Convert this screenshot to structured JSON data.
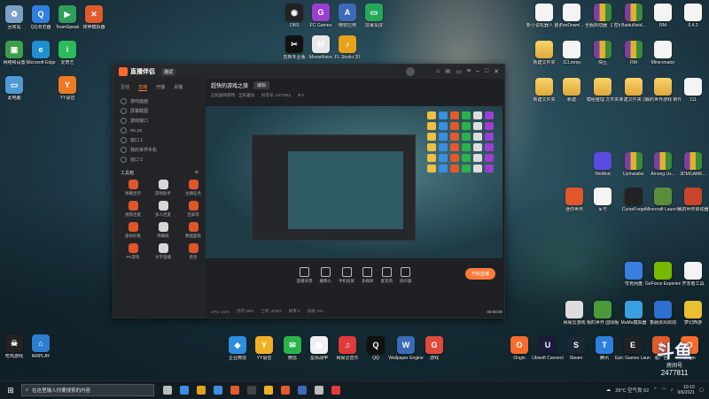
{
  "desktop": {
    "left_icons": [
      {
        "label": "回收站",
        "color": "#7aa0c8",
        "glyph": "♻"
      },
      {
        "label": "QQ浏览器",
        "color": "#2f7fe0",
        "glyph": "Q"
      },
      {
        "label": "TeamSpeak",
        "color": "#2e9e5b",
        "glyph": "▶"
      },
      {
        "label": "夜神模拟器",
        "color": "#e05a2a",
        "glyph": "✕"
      },
      {
        "label": "网络和设置",
        "color": "#3d9e4a",
        "glyph": "▣"
      },
      {
        "label": "Microsoft Edge",
        "color": "#1e8fd0",
        "glyph": "e"
      },
      {
        "label": "爱奇艺",
        "color": "#2bbb5b",
        "glyph": "i"
      },
      {
        "label": "此电脑",
        "color": "#4d9ad6",
        "glyph": "▭"
      },
      {
        "label": "YY语音",
        "color": "#f07a24",
        "glyph": "Y"
      }
    ],
    "top_icons": [
      {
        "label": "OBS",
        "color": "#222",
        "glyph": "◉"
      },
      {
        "label": "FC Games",
        "color": "#9b3fd0",
        "glyph": "G"
      },
      {
        "label": "微软应用",
        "color": "#3a6ab8",
        "glyph": "A"
      },
      {
        "label": "屏幕投屏",
        "color": "#24a85a",
        "glyph": "▭"
      },
      {
        "label": "剪映专业版",
        "color": "#111",
        "glyph": "✂"
      },
      {
        "label": "MovieMator",
        "color": "#e8e8e8",
        "glyph": "M"
      },
      {
        "label": "FL Studio 20",
        "color": "#e7a21c",
        "glyph": "♪"
      }
    ],
    "right_icons": [
      {
        "label": "新小说机器人 整合包（文...",
        "kind": "doc"
      },
      {
        "label": "PanDownl...",
        "kind": "doc"
      },
      {
        "label": "全服启动器 【 密码 1】",
        "kind": "winrar"
      },
      {
        "label": "BaiduNetd...",
        "kind": "winrar"
      },
      {
        "label": "RM",
        "kind": "doc"
      },
      {
        "label": "0.4.2",
        "kind": "doc"
      },
      {
        "label": "新建文件夹",
        "kind": "folder"
      },
      {
        "label": "111.mmp",
        "kind": "doc"
      },
      {
        "label": "快压",
        "kind": "winrar"
      },
      {
        "label": "RM",
        "kind": "winrar"
      },
      {
        "label": "Mine-imator",
        "kind": "doc"
      },
      {
        "label": "新建文件夹",
        "kind": "folder"
      },
      {
        "label": "新建",
        "kind": "folder"
      },
      {
        "label": "模组整理 文件夹",
        "kind": "folder"
      },
      {
        "label": "新建文件夹 (2)",
        "kind": "folder"
      },
      {
        "label": "我的世界游戏 制作",
        "kind": "folder"
      },
      {
        "label": "111",
        "kind": "doc"
      },
      {
        "label": "WeMod",
        "kind": "app",
        "color": "#5a4be0"
      },
      {
        "label": "UpInstaller",
        "kind": "winrar"
      },
      {
        "label": "Among.Us...",
        "kind": "winrar"
      },
      {
        "label": "3DMGAME...",
        "kind": "winrar"
      },
      {
        "label": "迷你世界",
        "kind": "app",
        "color": "#e0582a"
      },
      {
        "label": "军号",
        "kind": "doc"
      },
      {
        "label": "CurseForge",
        "kind": "app",
        "color": "#222"
      },
      {
        "label": "Minecraft Launcher",
        "kind": "app",
        "color": "#5b8d3a"
      },
      {
        "label": "我的世界启动器",
        "kind": "app",
        "color": "#c8442a"
      },
      {
        "label": "夸克网盘",
        "kind": "app",
        "color": "#3a7fe0"
      },
      {
        "label": "GeForce Experience",
        "kind": "app",
        "color": "#76b900"
      },
      {
        "label": "开发者工具",
        "kind": "doc"
      },
      {
        "label": "网易云游戏",
        "kind": "app",
        "color": "#ddd"
      },
      {
        "label": "我的世界 国际版",
        "kind": "app",
        "color": "#4a9a3a"
      },
      {
        "label": "MuMu模拟器",
        "kind": "app",
        "color": "#3aa0e0"
      },
      {
        "label": "香肠派对启动",
        "kind": "app",
        "color": "#2e6fd0"
      },
      {
        "label": "梦幻西游",
        "kind": "app",
        "color": "#e8c030"
      }
    ],
    "bottom_icons": [
      {
        "label": "吃鸡游戏",
        "color": "#222",
        "glyph": "☠"
      },
      {
        "label": "AIRPLAY",
        "color": "#2a7fd0",
        "glyph": "⌂"
      },
      {
        "label": "企业微信",
        "color": "#2e8fe0",
        "glyph": "◆"
      },
      {
        "label": "YY语音",
        "color": "#f0b024",
        "glyph": "Y"
      },
      {
        "label": "微信",
        "color": "#2ab34a",
        "glyph": "✉"
      },
      {
        "label": "星际战甲",
        "color": "#f0f0f0",
        "glyph": "▦"
      },
      {
        "label": "网易云音乐",
        "color": "#e03a3a",
        "glyph": "♫"
      },
      {
        "label": "QQ",
        "color": "#111",
        "glyph": "Q"
      },
      {
        "label": "Wallpaper Engine",
        "color": "#3a6ab8",
        "glyph": "W"
      },
      {
        "label": "游戏",
        "color": "#e04a3a",
        "glyph": "G"
      },
      {
        "label": "Origin",
        "color": "#f56c2d",
        "glyph": "O"
      },
      {
        "label": "Ubisoft Connect",
        "color": "#1a1a3a",
        "glyph": "U"
      },
      {
        "label": "Steam",
        "color": "#1b2838",
        "glyph": "S"
      },
      {
        "label": "腾讯",
        "color": "#2e7fe0",
        "glyph": "T"
      },
      {
        "label": "Epic Games Launcher",
        "color": "#222",
        "glyph": "E"
      },
      {
        "label": "看广告",
        "color": "#e05a2a",
        "glyph": "★"
      },
      {
        "label": "Origin",
        "color": "#f56c2d",
        "glyph": "O"
      }
    ]
  },
  "app": {
    "name": "直播伴侣",
    "version": "测试",
    "tabs": [
      "互动",
      "直播",
      "开播",
      "关播"
    ],
    "active_tab": "直播",
    "scenes": [
      "游戏画面",
      "屏幕截图",
      "游戏窗口",
      "mc pc",
      "窗口 1",
      "我的世界手机",
      "窗口 2"
    ],
    "toolbox_title": "工具箱",
    "tools": [
      "弹幕显示",
      "游戏助手",
      "主播任务",
      "视频连麦",
      "多人连麦",
      "连屏等",
      "虚拟形象",
      "弹幕姬",
      "数据面板",
      "PK游戏",
      "文字直播",
      "更多"
    ],
    "live_title": "超快的游戏之旅",
    "edit_label": "编辑",
    "meta_left": "这机器帅游戏 - 全民趣加",
    "meta_id_label": "抖音号:",
    "meta_id": "2477811",
    "viewers": "0",
    "controls": [
      "直播背景",
      "摄像头",
      "手机投屏",
      "多媒体",
      "麦克风",
      "扬声器"
    ],
    "start_button": "开始直播",
    "status_items": [
      "CPU: 22%",
      "内存:29%",
      "上传: 0KB/s",
      "帧率:0",
      "丢帧: 0%"
    ],
    "timer": "00:00:00"
  },
  "watermark": {
    "logo": "斗鱼",
    "room_label": "房间号",
    "room_id": "2477811"
  },
  "taskbar": {
    "search_placeholder": "在这里输入你要搜索的内容",
    "weather": "29°C 空气良 52",
    "time": "19:10",
    "date": "9/6/2021",
    "app_colors": [
      "#bbb",
      "#3a8fe0",
      "#e0a020",
      "#3a8fe0",
      "#e05a2a",
      "#444",
      "#f0b024",
      "#e05a2a",
      "#3a6ab8",
      "#bbb",
      "#e03a3a"
    ]
  }
}
